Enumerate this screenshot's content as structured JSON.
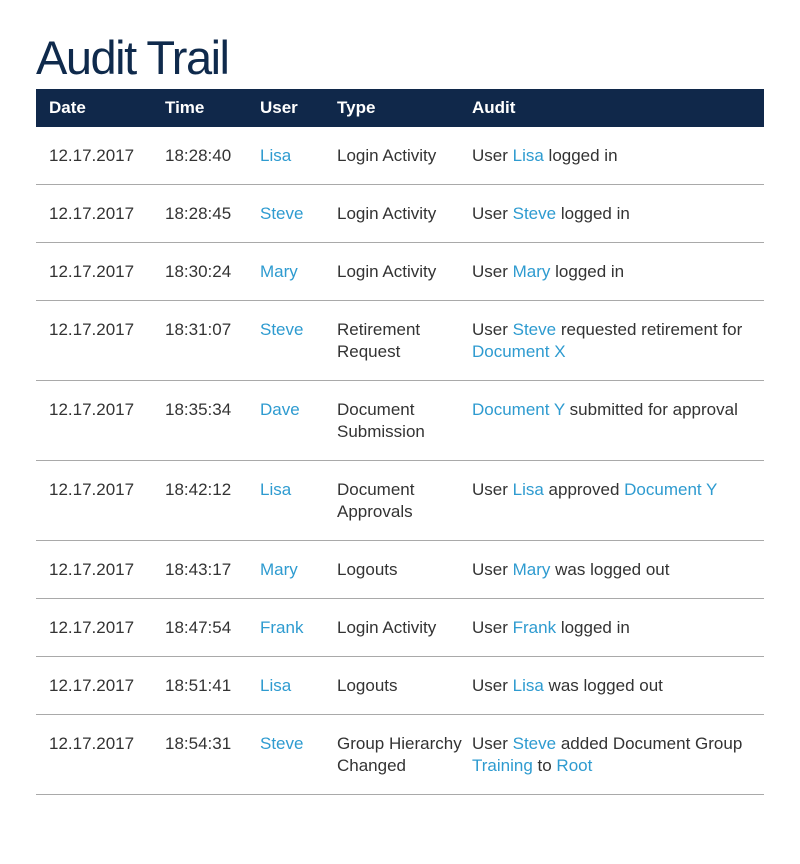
{
  "title": "Audit Trail",
  "colors": {
    "header_bg": "#10284a",
    "title": "#0f2a4c",
    "link": "#2e9bd0",
    "text": "#333333",
    "divider": "#a9a9a9"
  },
  "columns": [
    "Date",
    "Time",
    "User",
    "Type",
    "Audit"
  ],
  "rows": [
    {
      "date": "12.17.2017",
      "time": "18:28:40",
      "user": "Lisa",
      "type": "Login Activity",
      "audit": [
        {
          "t": "User "
        },
        {
          "t": "Lisa",
          "link": true
        },
        {
          "t": " logged in"
        }
      ]
    },
    {
      "date": "12.17.2017",
      "time": "18:28:45",
      "user": "Steve",
      "type": "Login Activity",
      "audit": [
        {
          "t": "User "
        },
        {
          "t": "Steve",
          "link": true
        },
        {
          "t": " logged in"
        }
      ]
    },
    {
      "date": "12.17.2017",
      "time": "18:30:24",
      "user": "Mary",
      "type": "Login Activity",
      "audit": [
        {
          "t": "User "
        },
        {
          "t": "Mary",
          "link": true
        },
        {
          "t": " logged in"
        }
      ]
    },
    {
      "date": "12.17.2017",
      "time": "18:31:07",
      "user": "Steve",
      "type": "Retirement Request",
      "audit": [
        {
          "t": "User "
        },
        {
          "t": "Steve",
          "link": true
        },
        {
          "t": " requested retirement for "
        },
        {
          "t": "Document X",
          "link": true
        }
      ]
    },
    {
      "date": "12.17.2017",
      "time": "18:35:34",
      "user": "Dave",
      "type": "Document Submission",
      "audit": [
        {
          "t": "Document Y",
          "link": true
        },
        {
          "t": " submitted for approval"
        }
      ]
    },
    {
      "date": "12.17.2017",
      "time": "18:42:12",
      "user": "Lisa",
      "type": "Document Approvals",
      "audit": [
        {
          "t": "User "
        },
        {
          "t": "Lisa",
          "link": true
        },
        {
          "t": " approved "
        },
        {
          "t": "Document Y",
          "link": true
        }
      ]
    },
    {
      "date": "12.17.2017",
      "time": "18:43:17",
      "user": "Mary",
      "type": "Logouts",
      "audit": [
        {
          "t": "User "
        },
        {
          "t": "Mary",
          "link": true
        },
        {
          "t": " was logged out"
        }
      ]
    },
    {
      "date": "12.17.2017",
      "time": "18:47:54",
      "user": "Frank",
      "type": "Login Activity",
      "audit": [
        {
          "t": "User "
        },
        {
          "t": "Frank",
          "link": true
        },
        {
          "t": " logged in"
        }
      ]
    },
    {
      "date": "12.17.2017",
      "time": "18:51:41",
      "user": "Lisa",
      "type": "Logouts",
      "audit": [
        {
          "t": "User "
        },
        {
          "t": "Lisa",
          "link": true
        },
        {
          "t": " was logged out"
        }
      ]
    },
    {
      "date": "12.17.2017",
      "time": "18:54:31",
      "user": "Steve",
      "type": "Group Hierarchy Changed",
      "audit": [
        {
          "t": "User "
        },
        {
          "t": "Steve",
          "link": true
        },
        {
          "t": " added Document Group "
        },
        {
          "t": "Training",
          "link": true
        },
        {
          "t": " to "
        },
        {
          "t": "Root",
          "link": true
        }
      ]
    }
  ]
}
